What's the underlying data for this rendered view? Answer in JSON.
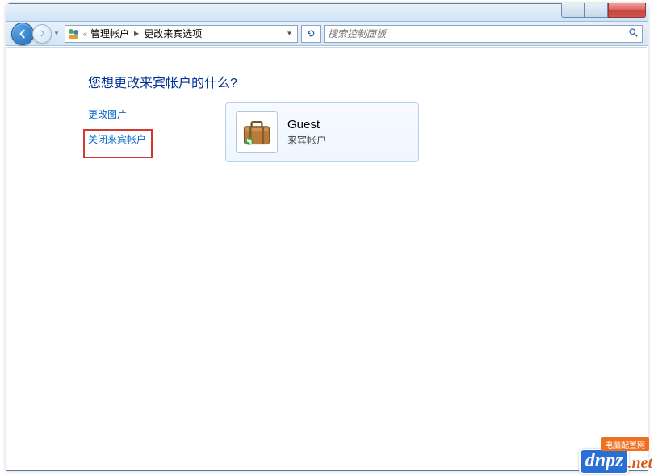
{
  "window_controls": {
    "minimize": "minimize",
    "maximize": "maximize",
    "close": "close"
  },
  "breadcrumb": {
    "prefix": "«",
    "parent": "管理帐户",
    "current": "更改来宾选项"
  },
  "search": {
    "placeholder": "搜索控制面板"
  },
  "content": {
    "heading": "您想更改来宾帐户的什么?",
    "links": {
      "change_picture": "更改图片",
      "turn_off_guest": "关闭来宾帐户"
    }
  },
  "account_card": {
    "name": "Guest",
    "type": "来宾帐户"
  },
  "watermark": {
    "tag": "电脑配置网",
    "brand": "dnpz",
    "suffix": ".net"
  }
}
